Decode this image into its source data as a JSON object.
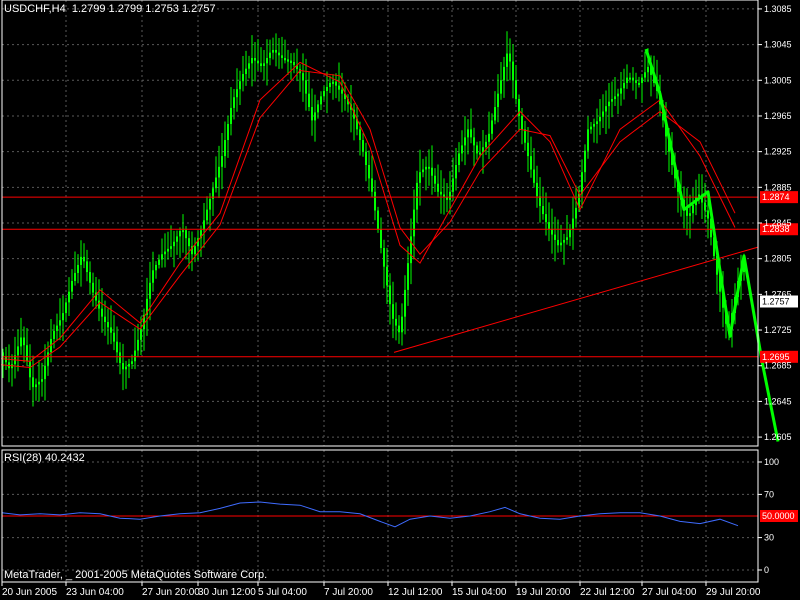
{
  "header": {
    "symbol_info": "USDCHF,H4  1.2799 1.2799 1.2753 1.2757"
  },
  "rsi_header": "RSI(28) 40.2432",
  "watermark": "MetaTrader, _ 2001-2005 MetaQuotes Software Corp.",
  "colors": {
    "background": "#000000",
    "grid": "#5a5a5a",
    "candles": "#00ff00",
    "moving_average": "#ff0000",
    "levels": "#ff0000",
    "trend_arrow": "#00ff00",
    "rsi_line": "#3f6cff",
    "text": "#ffffff"
  },
  "chart_data": [
    {
      "type": "candlestick",
      "title": "USDCHF,H4",
      "ylim": [
        1.2595,
        1.3095
      ],
      "yticks": [
        1.3085,
        1.3045,
        1.3005,
        1.2965,
        1.2925,
        1.2885,
        1.2845,
        1.2805,
        1.2765,
        1.2725,
        1.2685,
        1.2645,
        1.2605
      ],
      "ytick_labels": [
        "1.3085",
        "1.3045",
        "1.3005",
        "1.2965",
        "1.2925",
        "1.2885",
        "1.2845",
        "1.2805",
        "1.2765",
        "1.2725",
        "1.2685",
        "1.2645",
        "1.2605"
      ],
      "xtick_labels": [
        "20 Jun 2005",
        "23 Jun 04:00",
        "27 Jun 20:00",
        "30 Jun 12:00",
        "5 Jul 04:00",
        "7 Jul 20:00",
        "12 Jul 12:00",
        "15 Jul 04:00",
        "19 Jul 20:00",
        "22 Jul 12:00",
        "27 Jul 04:00",
        "29 Jul 20:00"
      ],
      "grid": true,
      "last_price": 1.2757,
      "last_price_label": "1.2757",
      "horizontal_levels": [
        {
          "value": 1.2874,
          "label": "1.2874"
        },
        {
          "value": 1.2838,
          "label": "1.2838"
        },
        {
          "value": 1.2695,
          "label": "1.2695"
        }
      ],
      "close_path": [
        [
          1,
          1.27
        ],
        [
          10,
          1.268
        ],
        [
          22,
          1.272
        ],
        [
          32,
          1.266
        ],
        [
          42,
          1.267
        ],
        [
          52,
          1.272
        ],
        [
          62,
          1.274
        ],
        [
          72,
          1.278
        ],
        [
          82,
          1.281
        ],
        [
          92,
          1.277
        ],
        [
          102,
          1.274
        ],
        [
          112,
          1.272
        ],
        [
          122,
          1.268
        ],
        [
          132,
          1.269
        ],
        [
          142,
          1.273
        ],
        [
          152,
          1.279
        ],
        [
          162,
          1.281
        ],
        [
          172,
          1.282
        ],
        [
          182,
          1.284
        ],
        [
          192,
          1.281
        ],
        [
          202,
          1.284
        ],
        [
          212,
          1.288
        ],
        [
          222,
          1.292
        ],
        [
          232,
          1.298
        ],
        [
          242,
          1.301
        ],
        [
          252,
          1.303
        ],
        [
          262,
          1.302
        ],
        [
          272,
          1.304
        ],
        [
          282,
          1.303
        ],
        [
          292,
          1.3025
        ],
        [
          302,
          1.301
        ],
        [
          312,
          1.296
        ],
        [
          322,
          1.299
        ],
        [
          332,
          1.3005
        ],
        [
          342,
          1.299
        ],
        [
          352,
          1.297
        ],
        [
          362,
          1.293
        ],
        [
          372,
          1.288
        ],
        [
          382,
          1.281
        ],
        [
          392,
          1.274
        ],
        [
          400,
          1.272
        ],
        [
          408,
          1.28
        ],
        [
          418,
          1.29
        ],
        [
          428,
          1.291
        ],
        [
          438,
          1.288
        ],
        [
          448,
          1.287
        ],
        [
          458,
          1.292
        ],
        [
          468,
          1.295
        ],
        [
          478,
          1.292
        ],
        [
          488,
          1.294
        ],
        [
          498,
          1.299
        ],
        [
          508,
          1.304
        ],
        [
          518,
          1.297
        ],
        [
          528,
          1.292
        ],
        [
          538,
          1.287
        ],
        [
          548,
          1.284
        ],
        [
          558,
          1.282
        ],
        [
          568,
          1.283
        ],
        [
          578,
          1.287
        ],
        [
          588,
          1.295
        ],
        [
          598,
          1.296
        ],
        [
          608,
          1.298
        ],
        [
          618,
          1.299
        ],
        [
          628,
          1.301
        ],
        [
          638,
          1.3
        ],
        [
          648,
          1.302
        ],
        [
          658,
          1.299
        ],
        [
          668,
          1.293
        ],
        [
          678,
          1.288
        ],
        [
          688,
          1.285
        ],
        [
          698,
          1.288
        ],
        [
          708,
          1.285
        ],
        [
          718,
          1.278
        ],
        [
          728,
          1.272
        ],
        [
          738,
          1.278
        ],
        [
          744,
          1.28
        ]
      ],
      "moving_averages": [
        {
          "points": [
            [
              1,
              1.2693
            ],
            [
              30,
              1.269
            ],
            [
              60,
              1.2716
            ],
            [
              100,
              1.277
            ],
            [
              140,
              1.2733
            ],
            [
              180,
              1.28
            ],
            [
              220,
              1.2856
            ],
            [
              260,
              1.2983
            ],
            [
              300,
              1.3025
            ],
            [
              340,
              1.3003
            ],
            [
              370,
              1.293
            ],
            [
              400,
              1.282
            ],
            [
              420,
              1.28
            ],
            [
              450,
              1.286
            ],
            [
              480,
              1.292
            ],
            [
              520,
              1.297
            ],
            [
              550,
              1.2936
            ],
            [
              580,
              1.286
            ],
            [
              620,
              1.295
            ],
            [
              660,
              1.2983
            ],
            [
              700,
              1.292
            ],
            [
              735,
              1.284
            ]
          ]
        },
        {
          "points": [
            [
              1,
              1.2686
            ],
            [
              30,
              1.2683
            ],
            [
              60,
              1.2706
            ],
            [
              100,
              1.2756
            ],
            [
              140,
              1.2726
            ],
            [
              180,
              1.2786
            ],
            [
              220,
              1.2843
            ],
            [
              260,
              1.2963
            ],
            [
              300,
              1.3016
            ],
            [
              340,
              1.301
            ],
            [
              370,
              1.295
            ],
            [
              400,
              1.284
            ],
            [
              420,
              1.281
            ],
            [
              450,
              1.2846
            ],
            [
              480,
              1.2903
            ],
            [
              520,
              1.295
            ],
            [
              550,
              1.2943
            ],
            [
              580,
              1.2876
            ],
            [
              620,
              1.2936
            ],
            [
              660,
              1.297
            ],
            [
              700,
              1.2936
            ],
            [
              735,
              1.2856
            ]
          ]
        }
      ],
      "trendline": {
        "from": [
          394,
          1.27
        ],
        "to": [
          758,
          1.2818
        ]
      },
      "arrow_path": [
        [
          646,
          1.304
        ],
        [
          660,
          1.299
        ],
        [
          684,
          1.286
        ],
        [
          708,
          1.288
        ],
        [
          730,
          1.2718
        ],
        [
          744,
          1.2808
        ],
        [
          762,
          1.269
        ],
        [
          778,
          1.26
        ]
      ]
    },
    {
      "type": "line",
      "title": "RSI(28) 40.2432",
      "ylim": [
        0,
        100
      ],
      "yticks": [
        100,
        70,
        30,
        0
      ],
      "ytick_labels": [
        "100",
        "70",
        "30",
        "0"
      ],
      "level": {
        "value": 50,
        "label": "50.0000"
      },
      "series": [
        {
          "x": [
            2,
            20,
            40,
            60,
            80,
            100,
            120,
            140,
            160,
            180,
            200,
            220,
            240,
            260,
            280,
            300,
            320,
            340,
            360,
            380,
            395,
            410,
            430,
            450,
            470,
            490,
            505,
            520,
            540,
            560,
            580,
            600,
            620,
            640,
            660,
            680,
            700,
            720,
            738
          ],
          "values": [
            53,
            51,
            52,
            51,
            53,
            52,
            48,
            47,
            50,
            52,
            53,
            57,
            62,
            63,
            61,
            60,
            54,
            54,
            52,
            45,
            40,
            47,
            50,
            48,
            50,
            54,
            58,
            52,
            48,
            47,
            50,
            52,
            53,
            53,
            50,
            45,
            43,
            47,
            41
          ]
        }
      ]
    }
  ]
}
